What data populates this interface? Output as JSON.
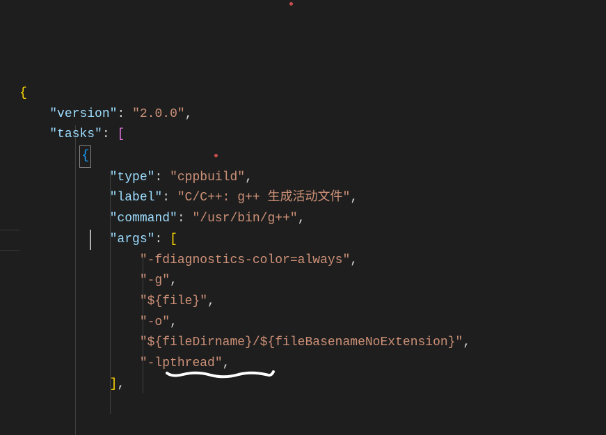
{
  "json": {
    "version_key": "\"version\"",
    "version_val": "\"2.0.0\"",
    "tasks_key": "\"tasks\"",
    "type_key": "\"type\"",
    "type_val": "\"cppbuild\"",
    "label_key": "\"label\"",
    "label_val": "\"C/C++: g++ 生成活动文件\"",
    "command_key": "\"command\"",
    "command_val": "\"/usr/bin/g++\"",
    "args_key": "\"args\"",
    "args": {
      "0": "\"-fdiagnostics-color=always\"",
      "1": "\"-g\"",
      "2": "\"${file}\"",
      "3": "\"-o\"",
      "4": "\"${fileDirname}/${fileBasenameNoExtension}\"",
      "5": "\"-lpthread\""
    }
  },
  "punct": {
    "open_brace": "{",
    "close_brace": "}",
    "open_bracket": "[",
    "close_bracket": "]",
    "colon": ":",
    "comma": ","
  }
}
